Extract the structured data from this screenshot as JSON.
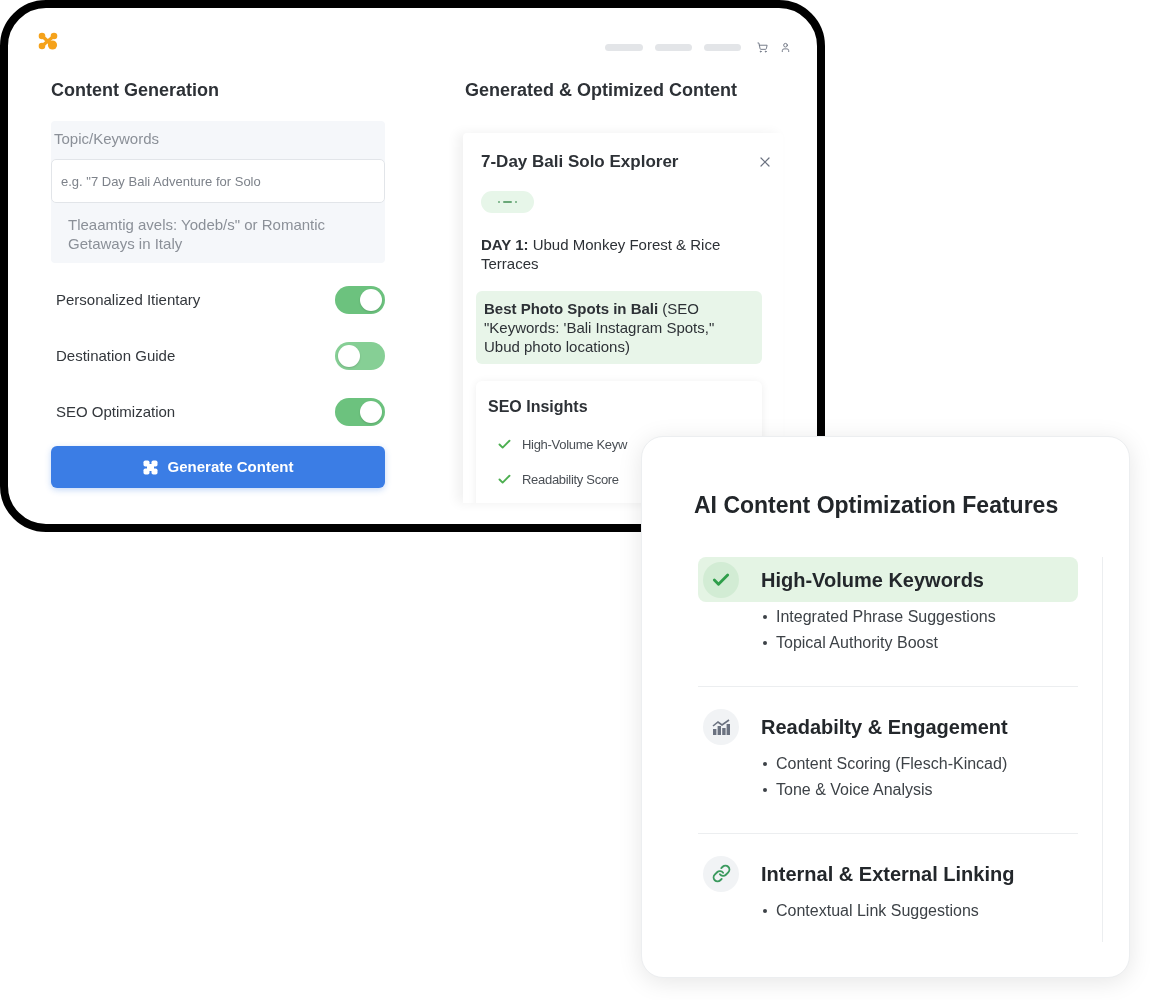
{
  "content_generation": {
    "title": "Content Generation",
    "topic": {
      "label": "Topic/Keywords",
      "placeholder": "e.g. \"7 Day Bali Adventure for Solo",
      "hint": "Tleaamtig avels: Yodeb/s\" or Romantic Getaways in Italy"
    },
    "toggles": [
      {
        "label": "Personalized Itientary",
        "on": true
      },
      {
        "label": "Destination Guide",
        "on": false
      },
      {
        "label": "SEO Optimization",
        "on": true
      }
    ],
    "generate_button": "Generate Content"
  },
  "generated_content": {
    "title": "Generated & Optimized Content",
    "card": {
      "title": "7-Day Bali Solo Explorer",
      "day": "**DAY 1:** Ubud Monkey Forest & Rice Terraces",
      "highlight": "**Best Photo Spots in Bali** (SEO \"Keywords: 'Bali Instagram Spots,\" Ubud photo locations)",
      "seo_insights": {
        "title": "SEO Insights",
        "items": [
          "High-Volume Keyw",
          "Readability Score"
        ]
      }
    }
  },
  "features_panel": {
    "title": "AI Content Optimization Features",
    "features": [
      {
        "title": "High-Volume Keywords",
        "selected": true,
        "bullets": [
          "Integrated Phrase Suggestions",
          "Topical Authority Boost"
        ]
      },
      {
        "title": "Readabilty & Engagement",
        "selected": false,
        "bullets": [
          "Content Scoring (Flesch-Kincad)",
          "Tone & Voice Analysis"
        ]
      },
      {
        "title": "Internal & External Linking",
        "selected": false,
        "bullets": [
          "Contextual Link Suggestions"
        ]
      }
    ]
  }
}
